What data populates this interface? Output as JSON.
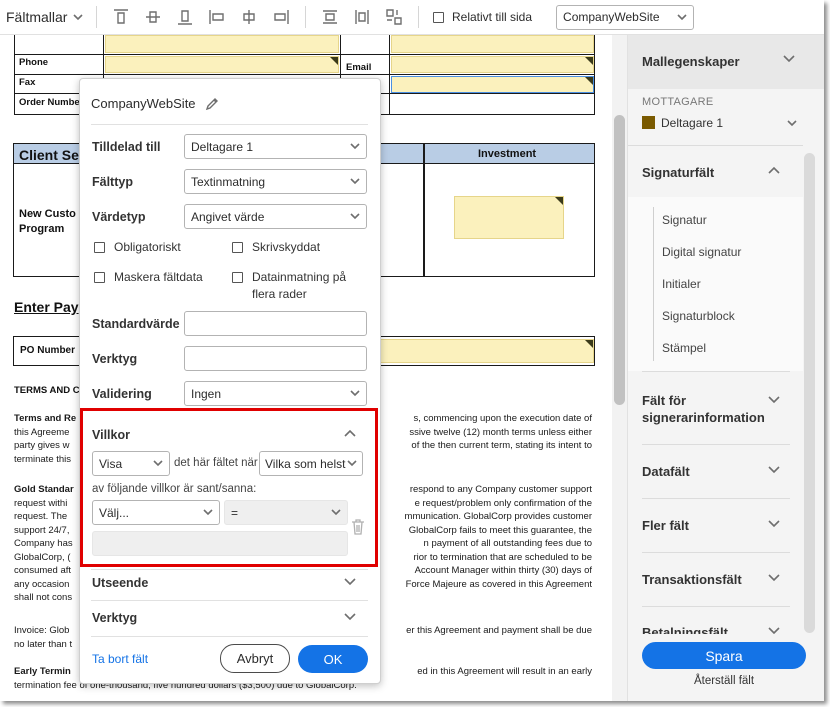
{
  "toolbar": {
    "menu_label": "Fältmallar",
    "relative_label": "Relativt till sida",
    "site_select": "CompanyWebSite"
  },
  "document": {
    "phone": "Phone",
    "email": "Email",
    "fax": "Fax",
    "order_number": "Order Numbe",
    "client_header": "Client Se",
    "investment": "Investment",
    "new_customer": "New Custo",
    "program": "Program",
    "enter_pay": "Enter Pay",
    "po_number": "PO Number",
    "terms_heading": "TERMS AND C",
    "p1_left": [
      "Terms and Re",
      "this Agreeme",
      "party gives w",
      "terminate this"
    ],
    "p1_right": [
      "s, commencing upon the execution date of",
      "ssive twelve (12) month terms unless either",
      "of the then current term, stating its intent to"
    ],
    "p2_left": [
      "Gold Standar",
      "request withi",
      "request. The",
      "support 24/7,",
      "Company has",
      "GlobalCorp, (",
      "consumed aft",
      "any occasion",
      "shall not cons"
    ],
    "p2_right": [
      "respond to any Company customer support",
      "e request/problem only confirmation of the",
      "mmunication. GlobalCorp provides customer",
      "GlobalCorp fails to meet this guarantee, the",
      "n payment of all outstanding fees due to",
      "rior to termination that are scheduled to be",
      "Account Manager within thirty (30) days of",
      "Force Majeure as covered in this Agreement"
    ],
    "p3_left": [
      "Invoice: Glob",
      "no later than t"
    ],
    "p3_right": [
      "er this Agreement and payment shall be due"
    ],
    "p4_left": [
      "Early Termin"
    ],
    "p4_right": [
      "ed in this Agreement will result in an early"
    ],
    "p4_last": "termination fee of one-thousand, five hundred dollars ($3,500) due to GlobalCorp."
  },
  "dialog": {
    "title": "CompanyWebSite",
    "assigned_label": "Tilldelad till",
    "assigned_value": "Deltagare 1",
    "fieldtype_label": "Fälttyp",
    "fieldtype_value": "Textinmatning",
    "valuetype_label": "Värdetyp",
    "valuetype_value": "Angivet värde",
    "required_label": "Obligatoriskt",
    "readonly_label": "Skrivskyddat",
    "mask_label": "Maskera fältdata",
    "multiline_label": "Datainmatning på flera rader",
    "default_label": "Standardvärde",
    "default_value": "",
    "tooltip_label": "Verktyg",
    "tooltip_value": "",
    "validation_label": "Validering",
    "validation_value": "Ingen",
    "conditions_label": "Villkor",
    "show_value": "Visa",
    "when_text": "det här fältet när",
    "any_value": "Vilka som helst",
    "following_text": "av följande villkor är sant/sanna:",
    "choose_value": "Välj...",
    "op_value": "=",
    "appearance_label": "Utseende",
    "tools_label": "Verktyg",
    "delete_link": "Ta bort fält",
    "cancel_button": "Avbryt",
    "ok_button": "OK"
  },
  "right_panel": {
    "field_props": "Mallegenskaper",
    "recipient_heading": "MOTTAGARE",
    "recipient_value": "Deltagare 1",
    "recipient_color": "#7a5a00",
    "signature_section": "Signaturfält",
    "signature_items": [
      "Signatur",
      "Digital signatur",
      "Initialer",
      "Signaturblock",
      "Stämpel"
    ],
    "signer_info": "Fält för signerarinformation",
    "data_fields": "Datafält",
    "more_fields": "Fler fält",
    "transaction_fields": "Transaktionsfält",
    "payment_fields": "Betalningsfält",
    "save_button": "Spara",
    "reset_link": "Återställ fält"
  },
  "colors": {
    "accent": "#1473e6",
    "highlight": "#e00000",
    "field_yellow": "#fbf1bd",
    "table_header": "#b9cde5"
  }
}
